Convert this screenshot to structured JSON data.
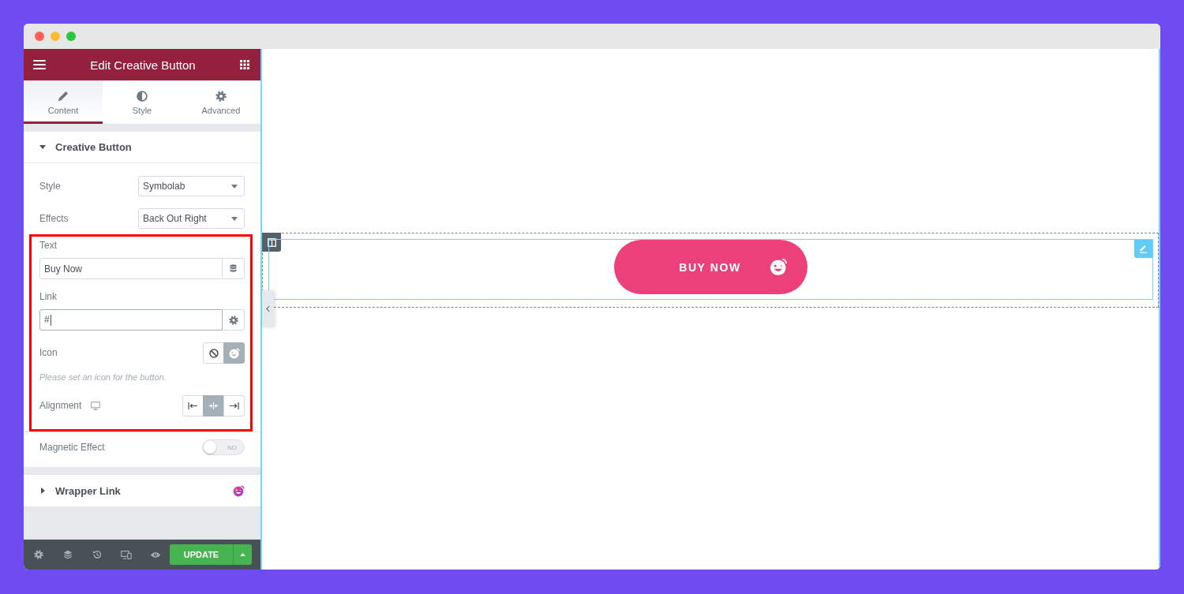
{
  "panel": {
    "header": {
      "title": "Edit Creative Button"
    },
    "tabs": [
      {
        "label": "Content",
        "selected": true
      },
      {
        "label": "Style",
        "selected": false
      },
      {
        "label": "Advanced",
        "selected": false
      }
    ],
    "sections": [
      {
        "title": "Creative Button",
        "expanded": true,
        "badge": false,
        "control_groups": [
          {
            "highlighted": false,
            "separator_before": false,
            "controls": [
              {
                "kind": "select",
                "label": "Style",
                "value": "Symbolab"
              },
              {
                "kind": "select",
                "label": "Effects",
                "value": "Back Out Right"
              }
            ]
          },
          {
            "highlighted": true,
            "separator_before": false,
            "controls": [
              {
                "kind": "text",
                "label": "Text",
                "value": "Buy Now",
                "focused": false
              },
              {
                "kind": "url",
                "label": "Link",
                "value": "#",
                "focused": true
              },
              {
                "kind": "choose",
                "label": "Icon",
                "responsive": false,
                "options": [
                  {
                    "kind": "none",
                    "selected": false
                  },
                  {
                    "kind": "icon",
                    "selected": true
                  }
                ]
              },
              {
                "kind": "hint",
                "text": "Please set an icon for the button."
              },
              {
                "kind": "choose",
                "label": "Alignment",
                "responsive": true,
                "options": [
                  {
                    "kind": "left",
                    "selected": false
                  },
                  {
                    "kind": "center",
                    "selected": true
                  },
                  {
                    "kind": "right",
                    "selected": false
                  }
                ]
              }
            ]
          },
          {
            "highlighted": false,
            "separator_before": true,
            "controls": [
              {
                "kind": "switch",
                "label": "Magnetic Effect",
                "on": false,
                "off_label": "NO"
              }
            ]
          }
        ]
      },
      {
        "title": "Wrapper Link",
        "expanded": false,
        "badge": true
      }
    ],
    "footer": {
      "update_label": "UPDATE"
    }
  },
  "canvas": {
    "button": {
      "label": "BUY NOW"
    }
  }
}
